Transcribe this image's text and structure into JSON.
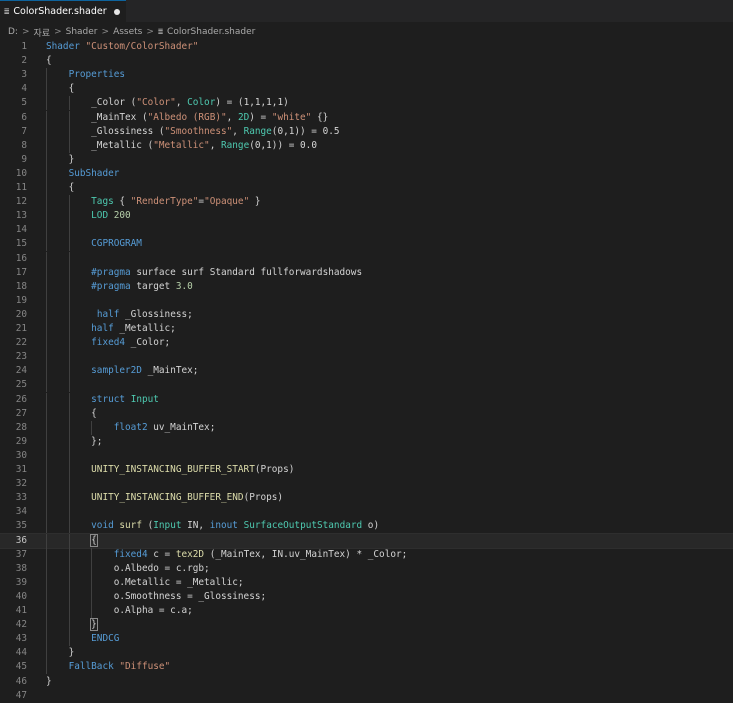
{
  "tab": {
    "title": "ColorShader.shader",
    "file_icon": "≣"
  },
  "breadcrumb": {
    "items": [
      "D:",
      "자료",
      "Shader",
      "Assets",
      "ColorShader.shader"
    ],
    "separator": ">",
    "file_icon": "≣"
  },
  "editor": {
    "current_line": 36,
    "lines": [
      [
        [
          "k",
          "Shader "
        ],
        [
          "s",
          "\"Custom/ColorShader\""
        ]
      ],
      [
        [
          "d",
          "{"
        ]
      ],
      [
        [
          "d",
          "    "
        ],
        [
          "k",
          "Properties"
        ]
      ],
      [
        [
          "d",
          "    {"
        ]
      ],
      [
        [
          "d",
          "        _Color ("
        ],
        [
          "s",
          "\"Color\""
        ],
        [
          "d",
          ", "
        ],
        [
          "t",
          "Color"
        ],
        [
          "d",
          ") = (1,1,1,1)"
        ]
      ],
      [
        [
          "d",
          "        _MainTex ("
        ],
        [
          "s",
          "\"Albedo (RGB)\""
        ],
        [
          "d",
          ", "
        ],
        [
          "t",
          "2D"
        ],
        [
          "d",
          ") = "
        ],
        [
          "s",
          "\"white\""
        ],
        [
          "d",
          " {}"
        ]
      ],
      [
        [
          "d",
          "        _Glossiness ("
        ],
        [
          "s",
          "\"Smoothness\""
        ],
        [
          "d",
          ", "
        ],
        [
          "t",
          "Range"
        ],
        [
          "d",
          "(0,1)) = 0.5"
        ]
      ],
      [
        [
          "d",
          "        _Metallic ("
        ],
        [
          "s",
          "\"Metallic\""
        ],
        [
          "d",
          ", "
        ],
        [
          "t",
          "Range"
        ],
        [
          "d",
          "(0,1)) = 0.0"
        ]
      ],
      [
        [
          "d",
          "    }"
        ]
      ],
      [
        [
          "d",
          "    "
        ],
        [
          "k",
          "SubShader"
        ]
      ],
      [
        [
          "d",
          "    {"
        ]
      ],
      [
        [
          "d",
          "        "
        ],
        [
          "t",
          "Tags"
        ],
        [
          "d",
          " { "
        ],
        [
          "s",
          "\"RenderType\""
        ],
        [
          "d",
          "="
        ],
        [
          "s",
          "\"Opaque\""
        ],
        [
          "d",
          " }"
        ]
      ],
      [
        [
          "d",
          "        "
        ],
        [
          "t",
          "LOD"
        ],
        [
          "d",
          " "
        ],
        [
          "n",
          "200"
        ]
      ],
      [],
      [
        [
          "d",
          "        "
        ],
        [
          "k",
          "CGPROGRAM"
        ]
      ],
      [],
      [
        [
          "d",
          "        "
        ],
        [
          "k",
          "#pragma"
        ],
        [
          "d",
          " surface surf Standard fullforwardshadows"
        ]
      ],
      [
        [
          "d",
          "        "
        ],
        [
          "k",
          "#pragma"
        ],
        [
          "d",
          " target "
        ],
        [
          "n",
          "3.0"
        ]
      ],
      [],
      [
        [
          "d",
          "         "
        ],
        [
          "k",
          "half"
        ],
        [
          "d",
          " _Glossiness;"
        ]
      ],
      [
        [
          "d",
          "        "
        ],
        [
          "k",
          "half"
        ],
        [
          "d",
          " _Metallic;"
        ]
      ],
      [
        [
          "d",
          "        "
        ],
        [
          "k",
          "fixed4"
        ],
        [
          "d",
          " _Color;"
        ]
      ],
      [],
      [
        [
          "d",
          "        "
        ],
        [
          "k",
          "sampler2D"
        ],
        [
          "d",
          " _MainTex;"
        ]
      ],
      [],
      [
        [
          "d",
          "        "
        ],
        [
          "k",
          "struct"
        ],
        [
          "d",
          " "
        ],
        [
          "t",
          "Input"
        ]
      ],
      [
        [
          "d",
          "        {"
        ]
      ],
      [
        [
          "d",
          "            "
        ],
        [
          "k",
          "float2"
        ],
        [
          "d",
          " uv_MainTex;"
        ]
      ],
      [
        [
          "d",
          "        };"
        ]
      ],
      [],
      [
        [
          "d",
          "        "
        ],
        [
          "f",
          "UNITY_INSTANCING_BUFFER_START"
        ],
        [
          "d",
          "(Props)"
        ]
      ],
      [],
      [
        [
          "d",
          "        "
        ],
        [
          "f",
          "UNITY_INSTANCING_BUFFER_END"
        ],
        [
          "d",
          "(Props)"
        ]
      ],
      [],
      [
        [
          "d",
          "        "
        ],
        [
          "k",
          "void"
        ],
        [
          "d",
          " "
        ],
        [
          "f",
          "surf"
        ],
        [
          "d",
          " ("
        ],
        [
          "t",
          "Input"
        ],
        [
          "d",
          " IN, "
        ],
        [
          "k",
          "inout"
        ],
        [
          "d",
          " "
        ],
        [
          "t",
          "SurfaceOutputStandard"
        ],
        [
          "d",
          " o)"
        ]
      ],
      [
        [
          "d",
          "        "
        ],
        [
          "bm",
          "{"
        ]
      ],
      [
        [
          "d",
          "            "
        ],
        [
          "k",
          "fixed4"
        ],
        [
          "d",
          " c = "
        ],
        [
          "f",
          "tex2D"
        ],
        [
          "d",
          " (_MainTex, IN.uv_MainTex) * _Color;"
        ]
      ],
      [
        [
          "d",
          "            o.Albedo = c.rgb;"
        ]
      ],
      [
        [
          "d",
          "            o.Metallic = _Metallic;"
        ]
      ],
      [
        [
          "d",
          "            o.Smoothness = _Glossiness;"
        ]
      ],
      [
        [
          "d",
          "            o.Alpha = c.a;"
        ]
      ],
      [
        [
          "d",
          "        "
        ],
        [
          "bm",
          "}"
        ]
      ],
      [
        [
          "d",
          "        "
        ],
        [
          "k",
          "ENDCG"
        ]
      ],
      [
        [
          "d",
          "    }"
        ]
      ],
      [
        [
          "d",
          "    "
        ],
        [
          "k",
          "FallBack"
        ],
        [
          "d",
          " "
        ],
        [
          "s",
          "\"Diffuse\""
        ]
      ],
      [
        [
          "d",
          "}"
        ]
      ],
      []
    ]
  }
}
